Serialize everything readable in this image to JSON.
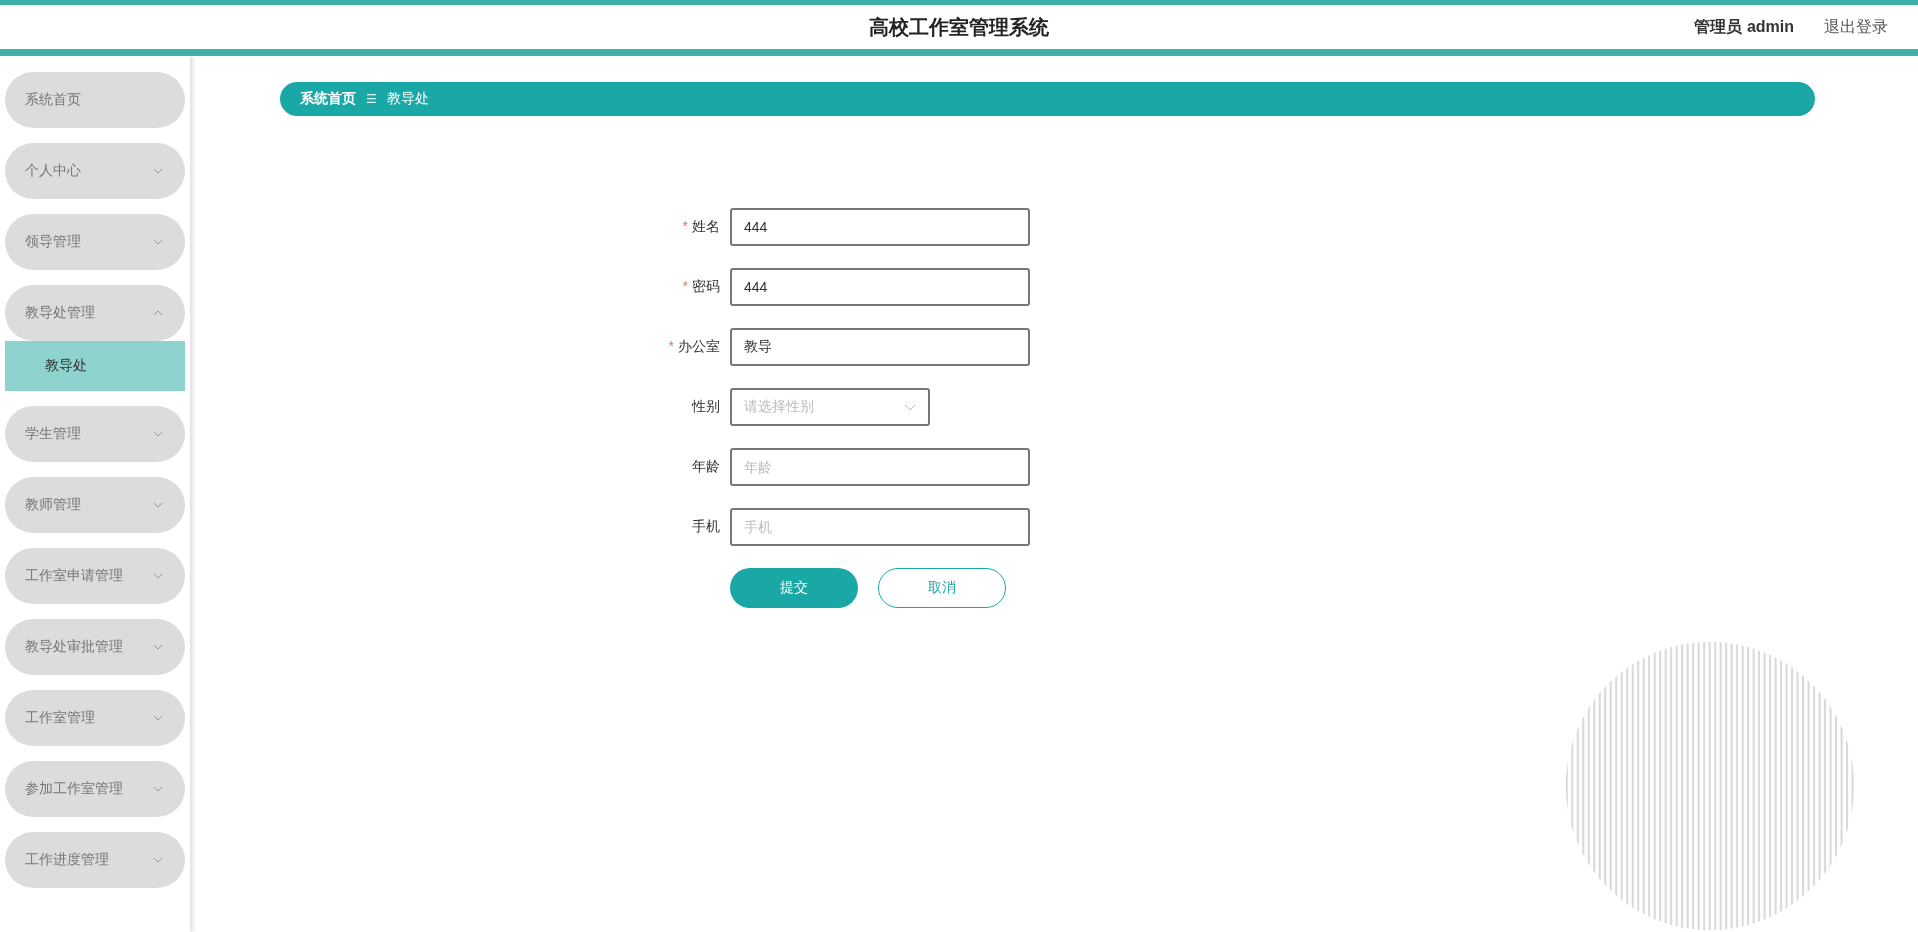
{
  "header": {
    "title": "高校工作室管理系统",
    "user": "管理员 admin",
    "logout": "退出登录"
  },
  "sidebar": {
    "items": [
      {
        "label": "系统首页",
        "kind": "link"
      },
      {
        "label": "个人中心",
        "kind": "menu",
        "expanded": false
      },
      {
        "label": "领导管理",
        "kind": "menu",
        "expanded": false
      },
      {
        "label": "教导处管理",
        "kind": "menu",
        "expanded": true,
        "children": [
          {
            "label": "教导处",
            "selected": true
          }
        ]
      },
      {
        "label": "学生管理",
        "kind": "menu",
        "expanded": false
      },
      {
        "label": "教师管理",
        "kind": "menu",
        "expanded": false
      },
      {
        "label": "工作室申请管理",
        "kind": "menu",
        "expanded": false
      },
      {
        "label": "教导处审批管理",
        "kind": "menu",
        "expanded": false
      },
      {
        "label": "工作室管理",
        "kind": "menu",
        "expanded": false
      },
      {
        "label": "参加工作室管理",
        "kind": "menu",
        "expanded": false
      },
      {
        "label": "工作进度管理",
        "kind": "menu",
        "expanded": false
      }
    ]
  },
  "breadcrumb": {
    "items": [
      "系统首页",
      "教导处"
    ],
    "separator": "☰"
  },
  "form": {
    "fields": [
      {
        "label": "姓名",
        "required_mark": "*",
        "kind": "input",
        "value": "444"
      },
      {
        "label": "密码",
        "required_mark": "*",
        "kind": "input",
        "value": "444"
      },
      {
        "label": "办公室",
        "required_mark": "*",
        "kind": "input",
        "value": "教导"
      },
      {
        "label": "性别",
        "kind": "select",
        "placeholder": "请选择性别"
      },
      {
        "label": "年龄",
        "kind": "input",
        "placeholder": "年龄"
      },
      {
        "label": "手机",
        "kind": "input",
        "placeholder": "手机"
      }
    ],
    "buttons": [
      {
        "label": "提交",
        "kind": "primary"
      },
      {
        "label": "取消",
        "kind": "secondary"
      }
    ]
  }
}
